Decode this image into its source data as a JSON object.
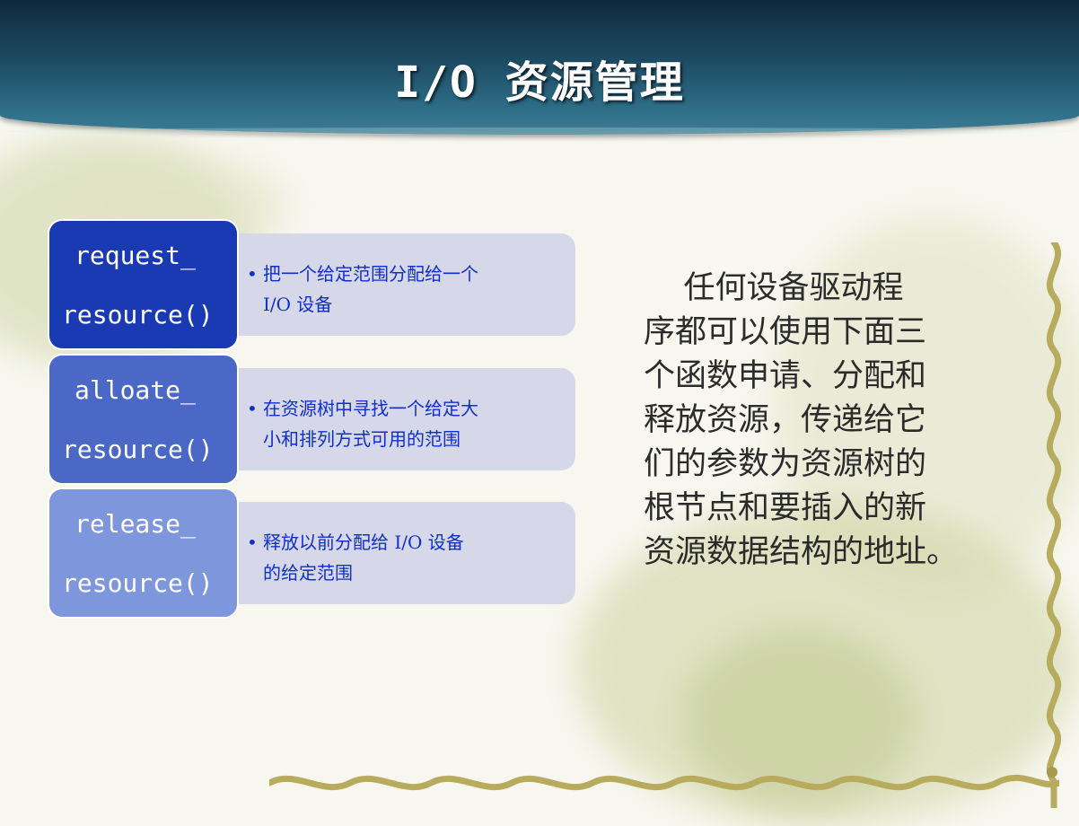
{
  "header": {
    "title": "I/O 资源管理"
  },
  "functions": [
    {
      "name_line1": "request_",
      "name_line2": "resource()",
      "description_lines": [
        "把一个给定范围分配给一个",
        "I/O 设备"
      ]
    },
    {
      "name_line1": "alloate_",
      "name_line2": "resource()",
      "description_lines": [
        "在资源树中寻找一个给定大",
        "小和排列方式可用的范围"
      ]
    },
    {
      "name_line1": "release_",
      "name_line2": "resource()",
      "description_lines": [
        "释放以前分配给 I/O 设备",
        "的给定范围"
      ]
    }
  ],
  "bullet": "•",
  "paragraph": {
    "lines": [
      "    任何设备驱动程",
      "序都可以使用下面三",
      "个函数申请、分配和",
      "释放资源，传递给它",
      "们的参数为资源树的",
      "根节点和要插入的新",
      "资源数据结构的地址。"
    ]
  },
  "colors": {
    "header_dark": "#0e2a3c",
    "header_light": "#3b7d94",
    "fn_1": "#1a3ab3",
    "fn_2": "#4b68c7",
    "fn_3": "#7e97dc",
    "desc_bg": "#d6d8ea",
    "desc_text": "#0f2fc9",
    "vine": "#b7ac5e"
  }
}
